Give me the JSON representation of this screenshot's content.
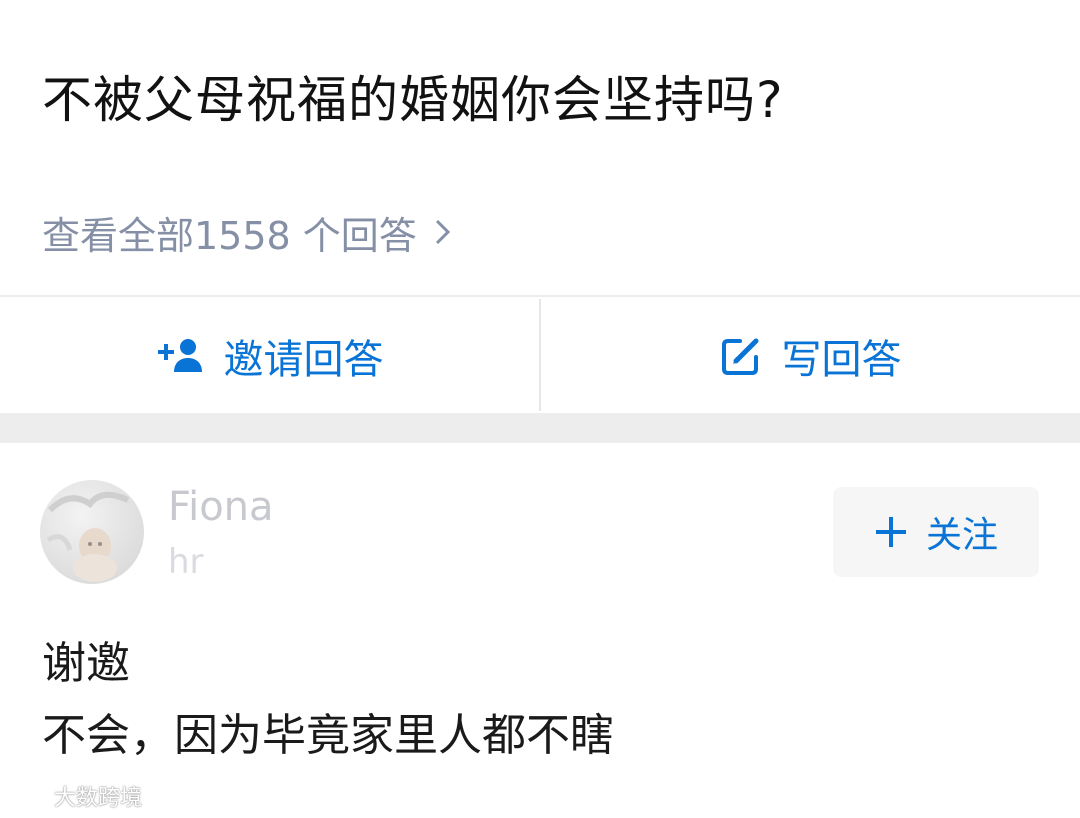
{
  "question": {
    "title": "不被父母祝福的婚姻你会坚持吗?",
    "answers_link": "查看全部1558 个回答",
    "chevron_icon": "chevron-right-icon"
  },
  "actions": {
    "invite_label": "邀请回答",
    "invite_icon": "add-person-icon",
    "write_label": "写回答",
    "write_icon": "edit-icon",
    "accent_color": "#0a74d6"
  },
  "answer": {
    "author": {
      "name": "Fiona",
      "headline": "hr"
    },
    "follow_label": "关注",
    "follow_icon": "plus-icon",
    "lines": [
      "谢邀",
      "不会，因为毕竟家里人都不瞎"
    ]
  },
  "watermark": {
    "text": "大数跨境"
  }
}
